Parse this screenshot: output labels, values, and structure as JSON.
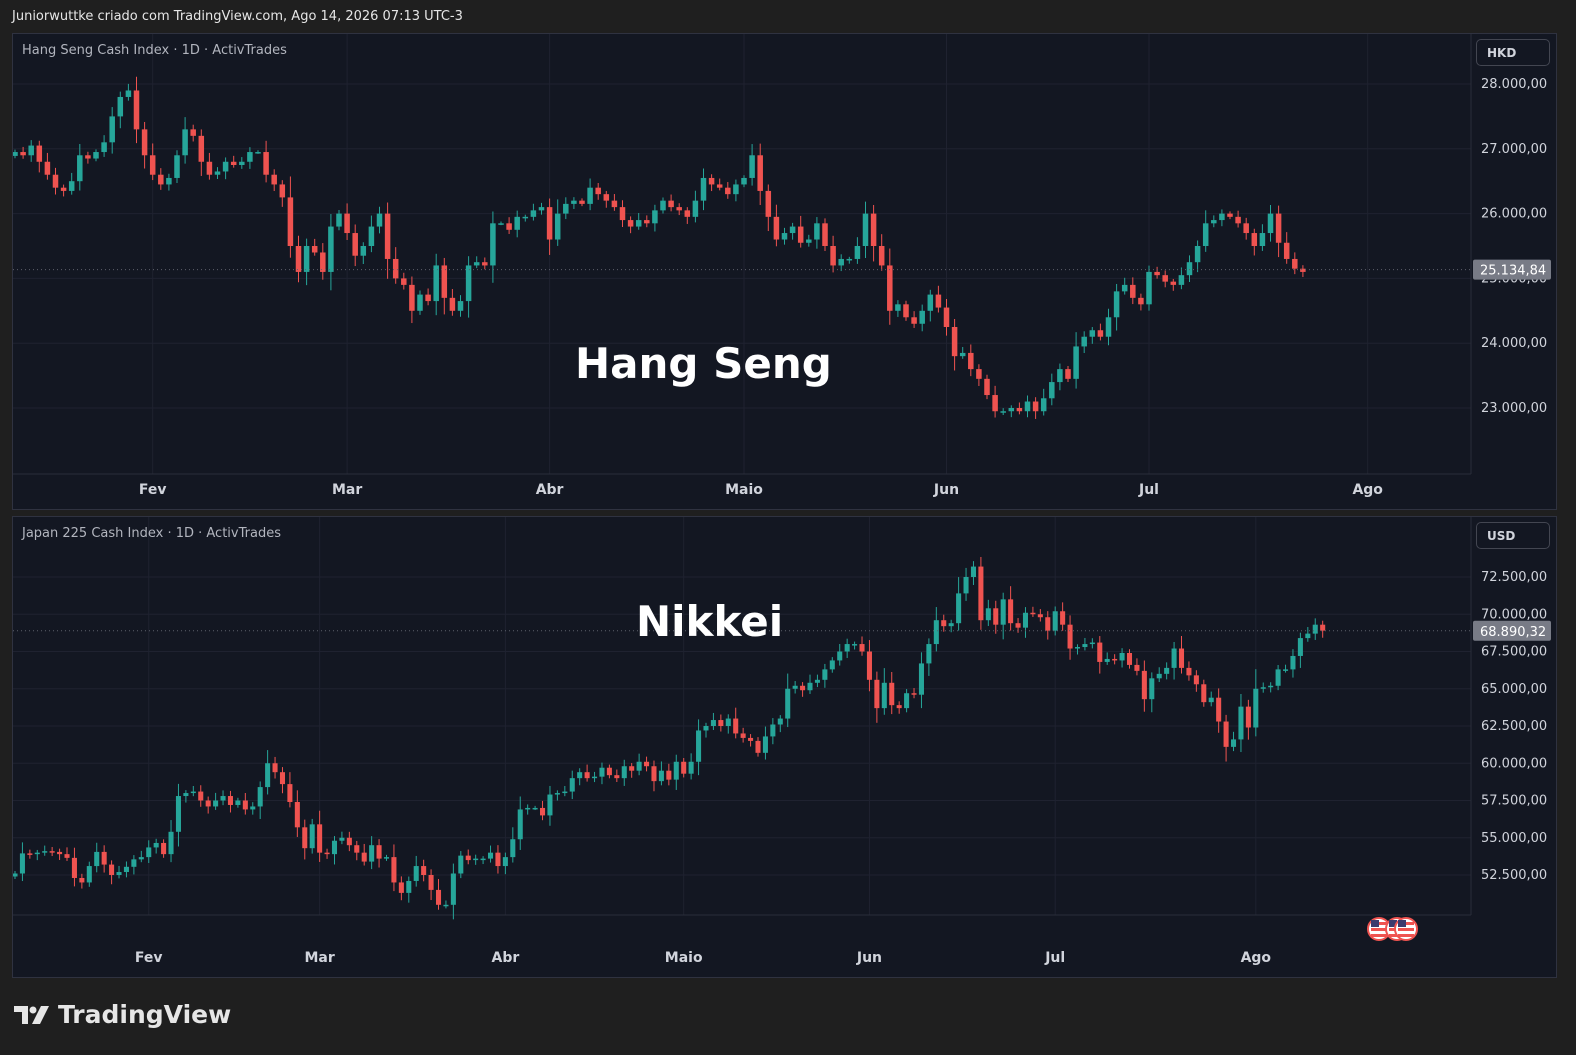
{
  "header": {
    "caption": "Juniorwuttke criado com TradingView.com, Ago 14, 2026 07:13 UTC-3"
  },
  "footer": {
    "logo_text": "TradingView",
    "icon": "tradingview-logo-icon"
  },
  "colors": {
    "up": "#26a69a",
    "down": "#ef5350",
    "background": "#131722",
    "grid": "#1f2230",
    "axis_text": "#d1d4dc"
  },
  "chart_data": [
    {
      "type": "candlestick",
      "title": "Hang Seng Cash Index · 1D · ActivTrades",
      "overlay_label": "Hang Seng",
      "currency": "HKD",
      "last_price_label": "25.134,84",
      "last_price": 25134.84,
      "ylim": [
        22000,
        28000
      ],
      "y_ticks": [
        28000,
        27000,
        26000,
        25000,
        24000,
        23000
      ],
      "y_tick_labels": [
        "28.000,00",
        "27.000,00",
        "26.000,00",
        "25.000,00",
        "24.000,00",
        "23.000,00"
      ],
      "x_labels": [
        "Fev",
        "Mar",
        "Abr",
        "Maio",
        "Jun",
        "Jul",
        "Ago"
      ],
      "x_label_index": [
        17,
        41,
        66,
        90,
        115,
        140,
        167
      ],
      "closes": [
        26950,
        26900,
        27050,
        26800,
        26600,
        26400,
        26350,
        26500,
        26900,
        26850,
        26950,
        27100,
        27500,
        27800,
        27900,
        27300,
        26900,
        26600,
        26450,
        26550,
        26900,
        27300,
        27200,
        26800,
        26600,
        26650,
        26800,
        26750,
        26800,
        26950,
        26950,
        26600,
        26450,
        26250,
        25500,
        25100,
        25500,
        25400,
        25100,
        25800,
        26000,
        25700,
        25350,
        25500,
        25800,
        26000,
        25300,
        25000,
        24900,
        24500,
        24750,
        24650,
        25200,
        24700,
        24500,
        24650,
        25200,
        25250,
        25200,
        25850,
        25850,
        25750,
        25950,
        25950,
        26050,
        26100,
        25600,
        26000,
        26150,
        26200,
        26150,
        26400,
        26300,
        26200,
        26100,
        25900,
        25800,
        25900,
        25850,
        26050,
        26200,
        26100,
        26050,
        25950,
        26200,
        26550,
        26450,
        26400,
        26300,
        26450,
        26550,
        26900,
        26350,
        25950,
        25600,
        25700,
        25800,
        25550,
        25600,
        25850,
        25500,
        25200,
        25300,
        25300,
        25500,
        26000,
        25500,
        25200,
        24500,
        24600,
        24400,
        24300,
        24500,
        24750,
        24550,
        24250,
        23800,
        23850,
        23600,
        23450,
        23200,
        22950,
        22950,
        23000,
        22950,
        23100,
        22950,
        23150,
        23400,
        23600,
        23450,
        23950,
        24100,
        24200,
        24100,
        24400,
        24800,
        24900,
        24700,
        24600,
        25100,
        25050,
        24950,
        24900,
        25050,
        25250,
        25500,
        25850,
        25900,
        26000,
        25950,
        25850,
        25700,
        25500,
        25700,
        26000,
        25550,
        25300,
        25150,
        25100
      ],
      "series": [
        {
          "name": "",
          "values": "closes"
        }
      ]
    },
    {
      "type": "candlestick",
      "title": "Japan 225 Cash Index · 1D · ActivTrades",
      "overlay_label": "Nikkei",
      "currency": "USD",
      "last_price_label": "68.890,32",
      "last_price": 68890.32,
      "ylim": [
        50000,
        75000
      ],
      "y_ticks": [
        72500,
        70000,
        67500,
        65000,
        62500,
        60000,
        57500,
        55000,
        52500
      ],
      "y_tick_labels": [
        "72.500,00",
        "70.000,00",
        "67.500,00",
        "65.000,00",
        "62.500,00",
        "60.000,00",
        "57.500,00",
        "55.000,00",
        "52.500,00"
      ],
      "x_labels": [
        "Fev",
        "Mar",
        "Abr",
        "Maio",
        "Jun",
        "Jul",
        "Ago"
      ],
      "x_label_index": [
        18,
        41,
        66,
        90,
        115,
        140,
        167
      ],
      "closes": [
        52600,
        53950,
        53900,
        54000,
        54100,
        54050,
        53900,
        53650,
        52300,
        52000,
        53100,
        54050,
        53200,
        52500,
        52700,
        53050,
        53550,
        53700,
        54350,
        54650,
        53900,
        55400,
        57800,
        58000,
        58100,
        57500,
        57100,
        57500,
        57800,
        57200,
        57500,
        56900,
        57100,
        58400,
        60000,
        59400,
        58600,
        57400,
        55700,
        54300,
        55900,
        54000,
        53900,
        54800,
        55000,
        54500,
        54000,
        53400,
        54500,
        53600,
        53700,
        52000,
        51300,
        52100,
        53100,
        52500,
        51500,
        50500,
        50500,
        52600,
        53800,
        53500,
        53600,
        53600,
        54000,
        53100,
        53700,
        54900,
        56900,
        57000,
        57000,
        56500,
        57900,
        58000,
        58100,
        59000,
        59400,
        59000,
        59100,
        59700,
        59200,
        59000,
        59800,
        59500,
        60100,
        59800,
        58800,
        59500,
        58900,
        60100,
        59300,
        60100,
        62200,
        62500,
        62900,
        62500,
        63000,
        62000,
        61700,
        61500,
        60700,
        61800,
        62600,
        63000,
        65000,
        65200,
        64900,
        65400,
        65600,
        66300,
        66900,
        67500,
        68000,
        68000,
        67500,
        65600,
        63700,
        65400,
        63900,
        63700,
        64700,
        64600,
        66700,
        68000,
        69600,
        69200,
        69400,
        71400,
        72500,
        73200,
        69600,
        70400,
        69300,
        71000,
        69400,
        69100,
        70100,
        70000,
        69800,
        68900,
        70200,
        69300,
        67700,
        67800,
        68000,
        68100,
        66800,
        67000,
        66900,
        67400,
        66600,
        66200,
        64300,
        65700,
        66000,
        66400,
        67700,
        66400,
        65900,
        65300,
        64100,
        64400,
        62800,
        61100,
        61600,
        63800,
        62400,
        65000,
        65100,
        65200,
        66300,
        66300,
        67200,
        68400,
        68700,
        69300,
        68900
      ],
      "series": [
        {
          "name": "",
          "values": "closes"
        }
      ]
    }
  ]
}
